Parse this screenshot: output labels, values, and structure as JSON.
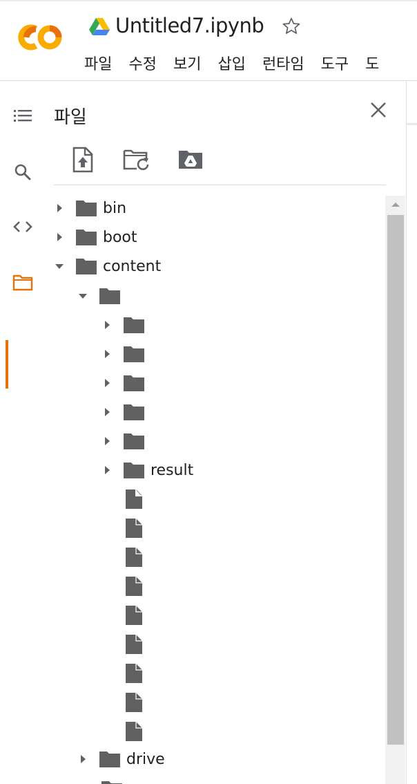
{
  "app": {
    "logo": "colab-logo",
    "notebook_title": "Untitled7.ipynb",
    "title_icon": "google-drive-icon",
    "star_icon": "star-outline-icon"
  },
  "menubar": [
    "파일",
    "수정",
    "보기",
    "삽입",
    "런타임",
    "도구",
    "도"
  ],
  "rail": {
    "items": [
      {
        "icon": "table-of-contents-icon",
        "active": false
      },
      {
        "icon": "search-icon",
        "active": false
      },
      {
        "icon": "code-snippets-icon",
        "active": false
      },
      {
        "icon": "folder-icon",
        "active": true
      }
    ],
    "accent": "#e8710a"
  },
  "panel": {
    "title": "파일",
    "close_icon": "close-icon",
    "toolbar": [
      {
        "icon": "upload-file-icon"
      },
      {
        "icon": "refresh-folder-icon"
      },
      {
        "icon": "mount-drive-icon"
      }
    ]
  },
  "tree": [
    {
      "type": "folder",
      "name": "bin",
      "depth": 0,
      "expanded": false
    },
    {
      "type": "folder",
      "name": "boot",
      "depth": 0,
      "expanded": false
    },
    {
      "type": "folder",
      "name": "content",
      "depth": 0,
      "expanded": true
    },
    {
      "type": "folder",
      "name": "",
      "depth": 1,
      "expanded": true
    },
    {
      "type": "folder",
      "name": "",
      "depth": 2,
      "expanded": false
    },
    {
      "type": "folder",
      "name": "",
      "depth": 2,
      "expanded": false
    },
    {
      "type": "folder",
      "name": "",
      "depth": 2,
      "expanded": false
    },
    {
      "type": "folder",
      "name": "",
      "depth": 2,
      "expanded": false
    },
    {
      "type": "folder",
      "name": "",
      "depth": 2,
      "expanded": false
    },
    {
      "type": "folder",
      "name": "result",
      "depth": 2,
      "expanded": false
    },
    {
      "type": "file",
      "name": "",
      "depth": 2
    },
    {
      "type": "file",
      "name": "",
      "depth": 2
    },
    {
      "type": "file",
      "name": "",
      "depth": 2
    },
    {
      "type": "file",
      "name": "",
      "depth": 2
    },
    {
      "type": "file",
      "name": "",
      "depth": 2
    },
    {
      "type": "file",
      "name": "",
      "depth": 2
    },
    {
      "type": "file",
      "name": "",
      "depth": 2
    },
    {
      "type": "file",
      "name": "",
      "depth": 2
    },
    {
      "type": "file",
      "name": "",
      "depth": 2
    },
    {
      "type": "folder",
      "name": "drive",
      "depth": 1,
      "expanded": false
    }
  ],
  "colors": {
    "icon_gray": "#5f6368",
    "folder_fill": "#616161",
    "text": "#202124",
    "scrollbar_thumb": "#c1c1c1"
  }
}
